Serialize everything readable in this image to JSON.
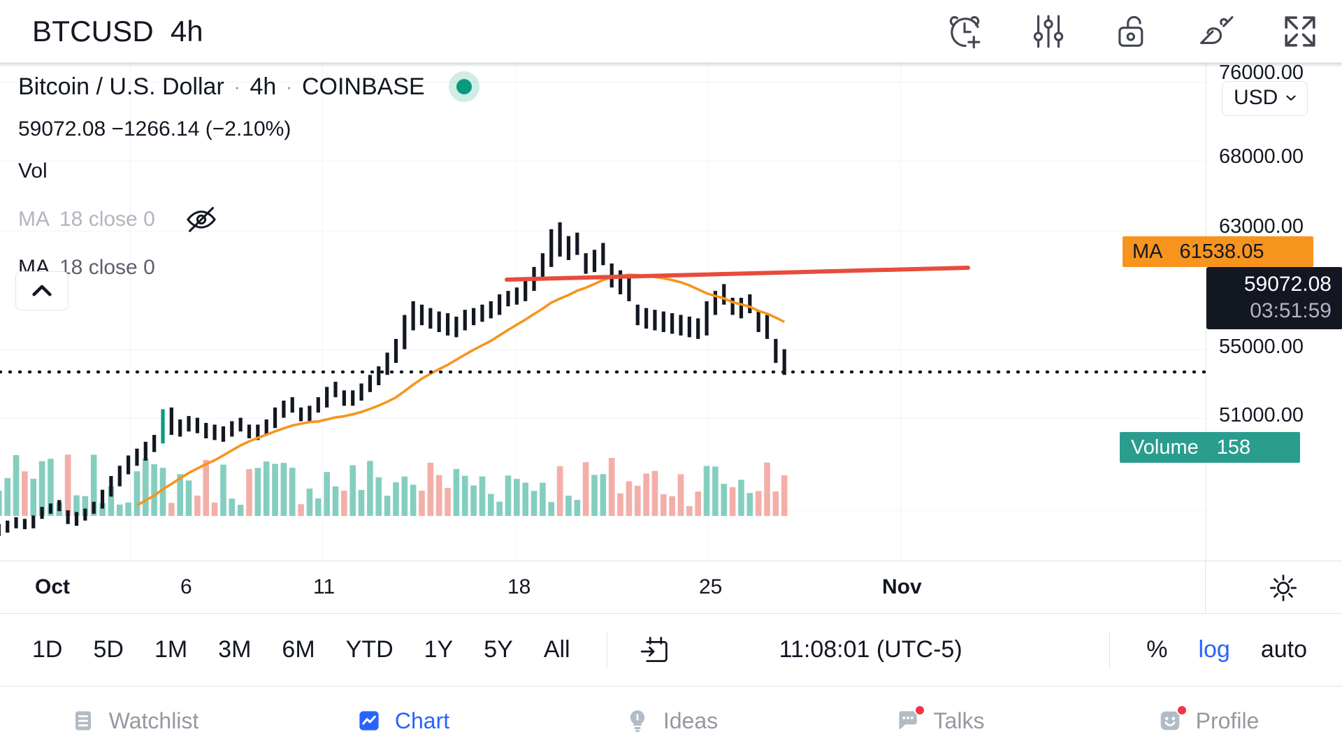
{
  "header": {
    "symbol": "BTCUSD",
    "interval": "4h",
    "icons": [
      {
        "name": "alarm-add-icon",
        "label": "Add alert"
      },
      {
        "name": "indicator-settings-icon",
        "label": "Indicators"
      },
      {
        "name": "unlock-icon",
        "label": "Unlock"
      },
      {
        "name": "drawing-tools-icon",
        "label": "Drawing tools"
      },
      {
        "name": "fullscreen-icon",
        "label": "Fullscreen"
      }
    ]
  },
  "legend": {
    "title_name": "Bitcoin / U.S. Dollar",
    "sep1": "·",
    "title_interval": "4h",
    "sep2": "·",
    "title_exchange": "COINBASE",
    "quote": "59072.08  −1266.14 (−2.10%)",
    "volume_label": "Vol",
    "ma_hidden": {
      "name": "MA",
      "values": "18 close 0"
    },
    "ma_visible": {
      "name": "MA",
      "values": "18 close 0"
    }
  },
  "price_scale": {
    "currency": "USD",
    "chevron": "⌄",
    "labels": [
      "76000.00",
      "68000.00",
      "63000.00",
      "55000.00",
      "51000.00"
    ],
    "ma_badge": {
      "label": "MA",
      "value": "61538.05",
      "color": "#f7941e"
    },
    "price_badge": {
      "price": "59072.08",
      "countdown": "03:51:59",
      "color": "#131722"
    },
    "volume_badge": {
      "label": "Volume",
      "value": "158",
      "color": "#2a9d8f"
    }
  },
  "time_axis": {
    "labels": [
      {
        "text": "Oct",
        "bold": true
      },
      {
        "text": "6",
        "bold": false
      },
      {
        "text": "11",
        "bold": false
      },
      {
        "text": "18",
        "bold": false
      },
      {
        "text": "25",
        "bold": false
      },
      {
        "text": "Nov",
        "bold": true
      }
    ],
    "settings_icon": "gear-icon"
  },
  "timeframe_bar": {
    "ranges": [
      "1D",
      "5D",
      "1M",
      "3M",
      "6M",
      "YTD",
      "1Y",
      "5Y",
      "All"
    ],
    "goto_date_icon": "calendar-arrow-icon",
    "clock": "11:08:01 (UTC-5)",
    "scale_options": [
      {
        "label": "%",
        "active": false
      },
      {
        "label": "log",
        "active": true
      },
      {
        "label": "auto",
        "active": false
      }
    ]
  },
  "bottom_nav": {
    "items": [
      {
        "label": "Watchlist",
        "icon": "watchlist-icon",
        "active": false,
        "dot": false
      },
      {
        "label": "Chart",
        "icon": "chart-icon",
        "active": true,
        "dot": false
      },
      {
        "label": "Ideas",
        "icon": "lightbulb-icon",
        "active": false,
        "dot": false
      },
      {
        "label": "Talks",
        "icon": "chat-icon",
        "active": false,
        "dot": true
      },
      {
        "label": "Profile",
        "icon": "profile-icon",
        "active": false,
        "dot": true
      }
    ]
  },
  "chart_data": {
    "type": "candlestick",
    "title": "Bitcoin / U.S. Dollar · 4h · COINBASE",
    "symbol": "BTCUSD",
    "interval": "4h",
    "exchange": "COINBASE",
    "last_price": 59072.08,
    "change": -1266.14,
    "change_pct": -2.1,
    "ylabel": "USD",
    "ylim": [
      49000,
      77000
    ],
    "yticks": [
      51000,
      55000,
      63000,
      68000,
      76000
    ],
    "xticks": [
      "Oct",
      "6",
      "11",
      "18",
      "25",
      "Nov"
    ],
    "grid": true,
    "legend_position": "top-left",
    "overlays": [
      {
        "name": "MA",
        "params": "18 close 0",
        "color": "#f7941e",
        "visible": true,
        "last_value": 61538.05
      },
      {
        "name": "MA",
        "params": "18 close 0",
        "color": "#b2b5be",
        "visible": false,
        "last_value": 0
      },
      {
        "name": "trendline",
        "color": "#e74c3c",
        "type": "ray"
      },
      {
        "name": "price-line",
        "color": "#131722",
        "style": "dotted",
        "value": 59072.08
      }
    ],
    "bar_color_up": "#089981",
    "bar_color_down": "#131722",
    "volume_color_up": "#6fc5b5",
    "volume_color_down": "#f2a099",
    "volume_last": 158,
    "ohlc": [
      [
        49400,
        49900,
        49200,
        49700
      ],
      [
        49700,
        50200,
        49500,
        49850
      ],
      [
        49850,
        50400,
        49700,
        50100
      ],
      [
        50100,
        50600,
        49950,
        50250
      ],
      [
        50250,
        50500,
        49900,
        50050
      ],
      [
        50050,
        50700,
        49950,
        50600
      ],
      [
        50600,
        51200,
        50500,
        51000
      ],
      [
        51000,
        51400,
        50800,
        51100
      ],
      [
        51100,
        51600,
        50950,
        51300
      ],
      [
        51300,
        51000,
        50200,
        50450
      ],
      [
        50450,
        50900,
        50100,
        50600
      ],
      [
        50600,
        51100,
        50400,
        50950
      ],
      [
        50950,
        51500,
        50800,
        51250
      ],
      [
        51250,
        52200,
        51100,
        52000
      ],
      [
        52000,
        53000,
        51800,
        52700
      ],
      [
        52700,
        53600,
        52400,
        53300
      ],
      [
        53300,
        54200,
        53100,
        53900
      ],
      [
        53900,
        54600,
        53600,
        54200
      ],
      [
        54200,
        55000,
        53900,
        54700
      ],
      [
        54700,
        55400,
        54400,
        55100
      ],
      [
        55100,
        56900,
        54900,
        56700
      ],
      [
        56700,
        57000,
        55400,
        55800
      ],
      [
        55800,
        56300,
        55300,
        56000
      ],
      [
        56000,
        56500,
        55600,
        56200
      ],
      [
        56200,
        56400,
        55500,
        55700
      ],
      [
        55700,
        56100,
        55200,
        55600
      ],
      [
        55600,
        56000,
        55100,
        55400
      ],
      [
        55400,
        55900,
        55000,
        55600
      ],
      [
        55600,
        56200,
        55300,
        55900
      ],
      [
        55900,
        56400,
        55600,
        56100
      ],
      [
        56100,
        56000,
        55200,
        55500
      ],
      [
        55500,
        56000,
        55100,
        55700
      ],
      [
        55700,
        56300,
        55400,
        56000
      ],
      [
        56000,
        57000,
        55800,
        56800
      ],
      [
        56800,
        57400,
        56400,
        57000
      ],
      [
        57000,
        57600,
        56700,
        57300
      ],
      [
        57300,
        57000,
        56200,
        56500
      ],
      [
        56500,
        57100,
        56200,
        56900
      ],
      [
        56900,
        57600,
        56700,
        57300
      ],
      [
        57300,
        58200,
        57000,
        57900
      ],
      [
        57900,
        58500,
        57600,
        58200
      ],
      [
        58200,
        58000,
        57100,
        57400
      ],
      [
        57400,
        58000,
        57100,
        57700
      ],
      [
        57700,
        58400,
        57400,
        58100
      ],
      [
        58100,
        58900,
        57900,
        58600
      ],
      [
        58600,
        59400,
        58300,
        59100
      ],
      [
        59100,
        60200,
        58900,
        59900
      ],
      [
        59900,
        61000,
        59600,
        60700
      ],
      [
        60700,
        62400,
        60400,
        62000
      ],
      [
        62000,
        63200,
        61500,
        62600
      ],
      [
        62600,
        63000,
        61800,
        62200
      ],
      [
        62200,
        62800,
        61600,
        62000
      ],
      [
        62000,
        62600,
        61400,
        61900
      ],
      [
        61900,
        62500,
        61200,
        61700
      ],
      [
        61700,
        62300,
        61100,
        61900
      ],
      [
        61900,
        62700,
        61500,
        62300
      ],
      [
        62300,
        62800,
        61800,
        62400
      ],
      [
        62400,
        63000,
        62000,
        62600
      ],
      [
        62600,
        63200,
        62200,
        62800
      ],
      [
        62800,
        63600,
        62400,
        63200
      ],
      [
        63200,
        63800,
        62900,
        63400
      ],
      [
        63400,
        64000,
        63000,
        63600
      ],
      [
        63600,
        64400,
        63200,
        64000
      ],
      [
        64000,
        65200,
        63800,
        64900
      ],
      [
        64900,
        66000,
        64600,
        65600
      ],
      [
        65600,
        67400,
        65200,
        67000
      ],
      [
        67000,
        67800,
        65800,
        66200
      ],
      [
        66200,
        67000,
        65600,
        66400
      ],
      [
        66400,
        67200,
        65900,
        66700
      ],
      [
        66700,
        66000,
        64800,
        65200
      ],
      [
        65200,
        66200,
        64900,
        65800
      ],
      [
        65800,
        66600,
        65300,
        66000
      ],
      [
        66000,
        65400,
        64000,
        64400
      ],
      [
        64400,
        65000,
        63600,
        64000
      ],
      [
        64000,
        64600,
        63200,
        63600
      ],
      [
        63600,
        63000,
        61800,
        62200
      ],
      [
        62200,
        62800,
        61600,
        62100
      ],
      [
        62100,
        62700,
        61500,
        62000
      ],
      [
        62000,
        62600,
        61400,
        61900
      ],
      [
        61900,
        62500,
        61300,
        61800
      ],
      [
        61800,
        62400,
        61200,
        61700
      ],
      [
        61700,
        62300,
        61100,
        61600
      ],
      [
        61600,
        62200,
        61000,
        61500
      ],
      [
        61500,
        63200,
        61200,
        62800
      ],
      [
        62800,
        63800,
        62400,
        63400
      ],
      [
        63400,
        64200,
        63000,
        63800
      ],
      [
        63800,
        63400,
        62400,
        62800
      ],
      [
        62800,
        63400,
        62200,
        62900
      ],
      [
        62900,
        63600,
        62500,
        63200
      ],
      [
        63200,
        62600,
        61400,
        61800
      ],
      [
        61800,
        62400,
        61000,
        61400
      ],
      [
        61400,
        61000,
        59600,
        59900
      ],
      [
        59900,
        60400,
        58900,
        59072
      ]
    ]
  }
}
